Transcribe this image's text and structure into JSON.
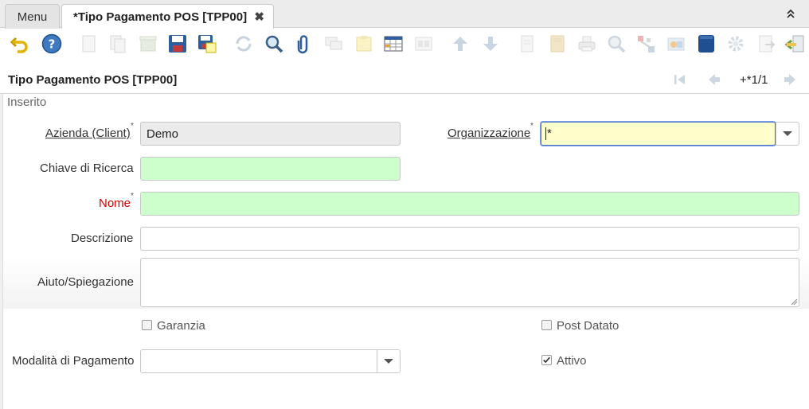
{
  "tabs": {
    "menu_label": "Menu",
    "active_label": "*Tipo Pagamento POS [TPP00]",
    "close_symbol": "✖"
  },
  "toolbar": {
    "icons": [
      "undo-icon",
      "help-icon",
      "new-record-icon",
      "copy-record-icon",
      "delete-icon",
      "save-icon",
      "save-and-new-icon",
      "refresh-icon",
      "find-icon",
      "attachment-icon",
      "chat-icon",
      "post-it-icon",
      "grid-toggle-icon",
      "multi-view-icon",
      "previous-record-icon",
      "next-record-icon",
      "report-icon",
      "archive-icon",
      "print-icon",
      "zoom-across-icon",
      "workflow-icon",
      "product-info-icon",
      "lock-icon",
      "process-icon",
      "export-icon",
      "exit-icon"
    ]
  },
  "header": {
    "title": "Tipo Pagamento POS [TPP00]",
    "record_counter": "+*1/1"
  },
  "status": {
    "text": "Inserito"
  },
  "form": {
    "client_label": "Azienda (Client)",
    "client_value": "Demo",
    "org_label": "Organizzazione",
    "org_value": "*",
    "search_key_label": "Chiave di Ricerca",
    "search_key_value": "",
    "name_label": "Nome",
    "name_value": "",
    "description_label": "Descrizione",
    "description_value": "",
    "help_label": "Aiuto/Spiegazione",
    "help_value": "",
    "guarantee_label": "Garanzia",
    "guarantee_checked": false,
    "postdated_label": "Post Datato",
    "postdated_checked": false,
    "payment_mode_label": "Modalità di Pagamento",
    "payment_mode_value": "",
    "active_label": "Attivo",
    "active_checked": true,
    "required_mark": "*"
  }
}
